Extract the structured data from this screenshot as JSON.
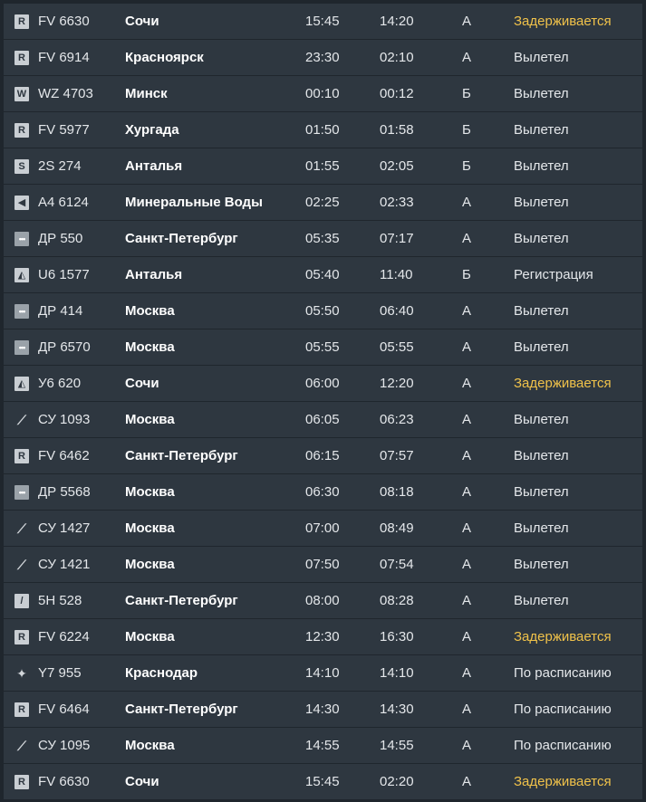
{
  "board": {
    "flights": [
      {
        "logo": "R",
        "logo_style": "sq",
        "flight": "FV 6630",
        "destination": "Сочи",
        "scheduled": "15:45",
        "actual": "14:20",
        "terminal": "A",
        "status": "Задерживается",
        "delayed": true
      },
      {
        "logo": "R",
        "logo_style": "sq",
        "flight": "FV 6914",
        "destination": "Красноярск",
        "scheduled": "23:30",
        "actual": "02:10",
        "terminal": "A",
        "status": "Вылетел",
        "delayed": false
      },
      {
        "logo": "W",
        "logo_style": "sq",
        "flight": "WZ 4703",
        "destination": "Минск",
        "scheduled": "00:10",
        "actual": "00:12",
        "terminal": "Б",
        "status": "Вылетел",
        "delayed": false
      },
      {
        "logo": "R",
        "logo_style": "sq",
        "flight": "FV 5977",
        "destination": "Хургада",
        "scheduled": "01:50",
        "actual": "01:58",
        "terminal": "Б",
        "status": "Вылетел",
        "delayed": false
      },
      {
        "logo": "S",
        "logo_style": "sq",
        "flight": "2S 274",
        "destination": "Анталья",
        "scheduled": "01:55",
        "actual": "02:05",
        "terminal": "Б",
        "status": "Вылетел",
        "delayed": false
      },
      {
        "logo": "◀",
        "logo_style": "sq",
        "flight": "A4 6124",
        "destination": "Минеральные Воды",
        "scheduled": "02:25",
        "actual": "02:33",
        "terminal": "A",
        "status": "Вылетел",
        "delayed": false
      },
      {
        "logo": "•••",
        "logo_style": "dots",
        "flight": "ДР 550",
        "destination": "Санкт-Петербург",
        "scheduled": "05:35",
        "actual": "07:17",
        "terminal": "A",
        "status": "Вылетел",
        "delayed": false
      },
      {
        "logo": "◭",
        "logo_style": "sq",
        "flight": "U6 1577",
        "destination": "Анталья",
        "scheduled": "05:40",
        "actual": "11:40",
        "terminal": "Б",
        "status": "Регистрация",
        "delayed": false
      },
      {
        "logo": "•••",
        "logo_style": "dots",
        "flight": "ДР 414",
        "destination": "Москва",
        "scheduled": "05:50",
        "actual": "06:40",
        "terminal": "A",
        "status": "Вылетел",
        "delayed": false
      },
      {
        "logo": "•••",
        "logo_style": "dots",
        "flight": "ДР 6570",
        "destination": "Москва",
        "scheduled": "05:55",
        "actual": "05:55",
        "terminal": "A",
        "status": "Вылетел",
        "delayed": false
      },
      {
        "logo": "◭",
        "logo_style": "sq",
        "flight": "У6 620",
        "destination": "Сочи",
        "scheduled": "06:00",
        "actual": "12:20",
        "terminal": "A",
        "status": "Задерживается",
        "delayed": true
      },
      {
        "logo": "⟋",
        "logo_style": "plain",
        "flight": "СУ 1093",
        "destination": "Москва",
        "scheduled": "06:05",
        "actual": "06:23",
        "terminal": "A",
        "status": "Вылетел",
        "delayed": false
      },
      {
        "logo": "R",
        "logo_style": "sq",
        "flight": "FV 6462",
        "destination": "Санкт-Петербург",
        "scheduled": "06:15",
        "actual": "07:57",
        "terminal": "A",
        "status": "Вылетел",
        "delayed": false
      },
      {
        "logo": "•••",
        "logo_style": "dots",
        "flight": "ДР 5568",
        "destination": "Москва",
        "scheduled": "06:30",
        "actual": "08:18",
        "terminal": "A",
        "status": "Вылетел",
        "delayed": false
      },
      {
        "logo": "⟋",
        "logo_style": "plain",
        "flight": "СУ 1427",
        "destination": "Москва",
        "scheduled": "07:00",
        "actual": "08:49",
        "terminal": "A",
        "status": "Вылетел",
        "delayed": false
      },
      {
        "logo": "⟋",
        "logo_style": "plain",
        "flight": "СУ 1421",
        "destination": "Москва",
        "scheduled": "07:50",
        "actual": "07:54",
        "terminal": "A",
        "status": "Вылетел",
        "delayed": false
      },
      {
        "logo": "/",
        "logo_style": "sq",
        "flight": "5H 528",
        "destination": "Санкт-Петербург",
        "scheduled": "08:00",
        "actual": "08:28",
        "terminal": "A",
        "status": "Вылетел",
        "delayed": false
      },
      {
        "logo": "R",
        "logo_style": "sq",
        "flight": "FV 6224",
        "destination": "Москва",
        "scheduled": "12:30",
        "actual": "16:30",
        "terminal": "A",
        "status": "Задерживается",
        "delayed": true
      },
      {
        "logo": "✦",
        "logo_style": "plain",
        "flight": "Y7 955",
        "destination": "Краснодар",
        "scheduled": "14:10",
        "actual": "14:10",
        "terminal": "A",
        "status": "По расписанию",
        "delayed": false
      },
      {
        "logo": "R",
        "logo_style": "sq",
        "flight": "FV 6464",
        "destination": "Санкт-Петербург",
        "scheduled": "14:30",
        "actual": "14:30",
        "terminal": "A",
        "status": "По расписанию",
        "delayed": false
      },
      {
        "logo": "⟋",
        "logo_style": "plain",
        "flight": "СУ 1095",
        "destination": "Москва",
        "scheduled": "14:55",
        "actual": "14:55",
        "terminal": "A",
        "status": "По расписанию",
        "delayed": false
      },
      {
        "logo": "R",
        "logo_style": "sq",
        "flight": "FV 6630",
        "destination": "Сочи",
        "scheduled": "15:45",
        "actual": "02:20",
        "terminal": "A",
        "status": "Задерживается",
        "delayed": true
      }
    ]
  },
  "colors": {
    "background": "#1f262d",
    "row": "#2e3740",
    "text": "#ffffff",
    "delayed": "#f0c24a"
  },
  "icons": {
    "airline_logo": "airline-logo-icon"
  }
}
